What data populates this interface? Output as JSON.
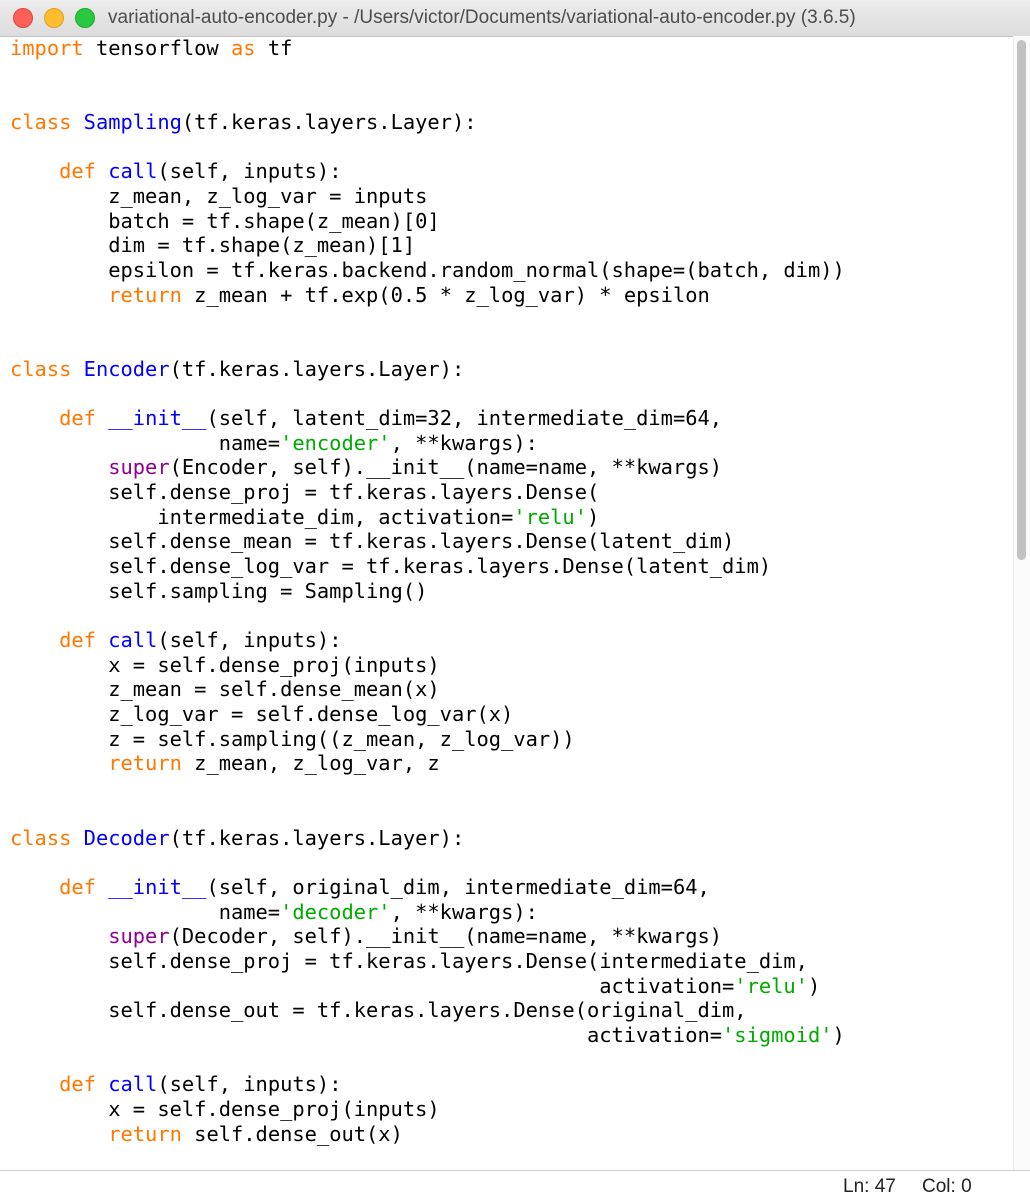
{
  "window": {
    "title": "variational-auto-encoder.py - /Users/victor/Documents/variational-auto-encoder.py (3.6.5)",
    "buttons": [
      "close",
      "minimize",
      "zoom"
    ]
  },
  "syntax_colors": {
    "keyword": "#ff7700",
    "builtin": "#900090",
    "definition": "#0000ff",
    "string": "#00aa00",
    "plain": "#000000"
  },
  "editor": {
    "lines": [
      [
        [
          "keyword",
          "import"
        ],
        [
          "plain",
          " tensorflow "
        ],
        [
          "keyword",
          "as"
        ],
        [
          "plain",
          " tf"
        ]
      ],
      [],
      [],
      [
        [
          "keyword",
          "class"
        ],
        [
          "plain",
          " "
        ],
        [
          "def",
          "Sampling"
        ],
        [
          "plain",
          "(tf.keras.layers.Layer):"
        ]
      ],
      [],
      [
        [
          "plain",
          "    "
        ],
        [
          "keyword",
          "def"
        ],
        [
          "plain",
          " "
        ],
        [
          "def",
          "call"
        ],
        [
          "plain",
          "(self, inputs):"
        ]
      ],
      [
        [
          "plain",
          "        z_mean, z_log_var = inputs"
        ]
      ],
      [
        [
          "plain",
          "        batch = tf.shape(z_mean)[0]"
        ]
      ],
      [
        [
          "plain",
          "        dim = tf.shape(z_mean)[1]"
        ]
      ],
      [
        [
          "plain",
          "        epsilon = tf.keras.backend.random_normal(shape=(batch, dim))"
        ]
      ],
      [
        [
          "plain",
          "        "
        ],
        [
          "keyword",
          "return"
        ],
        [
          "plain",
          " z_mean + tf.exp(0.5 * z_log_var) * epsilon"
        ]
      ],
      [],
      [],
      [
        [
          "keyword",
          "class"
        ],
        [
          "plain",
          " "
        ],
        [
          "def",
          "Encoder"
        ],
        [
          "plain",
          "(tf.keras.layers.Layer):"
        ]
      ],
      [],
      [
        [
          "plain",
          "    "
        ],
        [
          "keyword",
          "def"
        ],
        [
          "plain",
          " "
        ],
        [
          "def",
          "__init__"
        ],
        [
          "plain",
          "(self, latent_dim=32, intermediate_dim=64,"
        ]
      ],
      [
        [
          "plain",
          "                 name="
        ],
        [
          "string",
          "'encoder'"
        ],
        [
          "plain",
          ", **kwargs):"
        ]
      ],
      [
        [
          "plain",
          "        "
        ],
        [
          "builtin",
          "super"
        ],
        [
          "plain",
          "(Encoder, self).__init__(name=name, **kwargs)"
        ]
      ],
      [
        [
          "plain",
          "        self.dense_proj = tf.keras.layers.Dense("
        ]
      ],
      [
        [
          "plain",
          "            intermediate_dim, activation="
        ],
        [
          "string",
          "'relu'"
        ],
        [
          "plain",
          ")"
        ]
      ],
      [
        [
          "plain",
          "        self.dense_mean = tf.keras.layers.Dense(latent_dim)"
        ]
      ],
      [
        [
          "plain",
          "        self.dense_log_var = tf.keras.layers.Dense(latent_dim)"
        ]
      ],
      [
        [
          "plain",
          "        self.sampling = Sampling()"
        ]
      ],
      [],
      [
        [
          "plain",
          "    "
        ],
        [
          "keyword",
          "def"
        ],
        [
          "plain",
          " "
        ],
        [
          "def",
          "call"
        ],
        [
          "plain",
          "(self, inputs):"
        ]
      ],
      [
        [
          "plain",
          "        x = self.dense_proj(inputs)"
        ]
      ],
      [
        [
          "plain",
          "        z_mean = self.dense_mean(x)"
        ]
      ],
      [
        [
          "plain",
          "        z_log_var = self.dense_log_var(x)"
        ]
      ],
      [
        [
          "plain",
          "        z = self.sampling((z_mean, z_log_var))"
        ]
      ],
      [
        [
          "plain",
          "        "
        ],
        [
          "keyword",
          "return"
        ],
        [
          "plain",
          " z_mean, z_log_var, z"
        ]
      ],
      [],
      [],
      [
        [
          "keyword",
          "class"
        ],
        [
          "plain",
          " "
        ],
        [
          "def",
          "Decoder"
        ],
        [
          "plain",
          "(tf.keras.layers.Layer):"
        ]
      ],
      [],
      [
        [
          "plain",
          "    "
        ],
        [
          "keyword",
          "def"
        ],
        [
          "plain",
          " "
        ],
        [
          "def",
          "__init__"
        ],
        [
          "plain",
          "(self, original_dim, intermediate_dim=64,"
        ]
      ],
      [
        [
          "plain",
          "                 name="
        ],
        [
          "string",
          "'decoder'"
        ],
        [
          "plain",
          ", **kwargs):"
        ]
      ],
      [
        [
          "plain",
          "        "
        ],
        [
          "builtin",
          "super"
        ],
        [
          "plain",
          "(Decoder, self).__init__(name=name, **kwargs)"
        ]
      ],
      [
        [
          "plain",
          "        self.dense_proj = tf.keras.layers.Dense(intermediate_dim,"
        ]
      ],
      [
        [
          "plain",
          "                                                activation="
        ],
        [
          "string",
          "'relu'"
        ],
        [
          "plain",
          ")"
        ]
      ],
      [
        [
          "plain",
          "        self.dense_out = tf.keras.layers.Dense(original_dim,"
        ]
      ],
      [
        [
          "plain",
          "                                               activation="
        ],
        [
          "string",
          "'sigmoid'"
        ],
        [
          "plain",
          ")"
        ]
      ],
      [],
      [
        [
          "plain",
          "    "
        ],
        [
          "keyword",
          "def"
        ],
        [
          "plain",
          " "
        ],
        [
          "def",
          "call"
        ],
        [
          "plain",
          "(self, inputs):"
        ]
      ],
      [
        [
          "plain",
          "        x = self.dense_proj(inputs)"
        ]
      ],
      [
        [
          "plain",
          "        "
        ],
        [
          "keyword",
          "return"
        ],
        [
          "plain",
          " self.dense_out(x)"
        ]
      ]
    ]
  },
  "status": {
    "line_label": "Ln: 47",
    "col_label": "Col: 0"
  }
}
